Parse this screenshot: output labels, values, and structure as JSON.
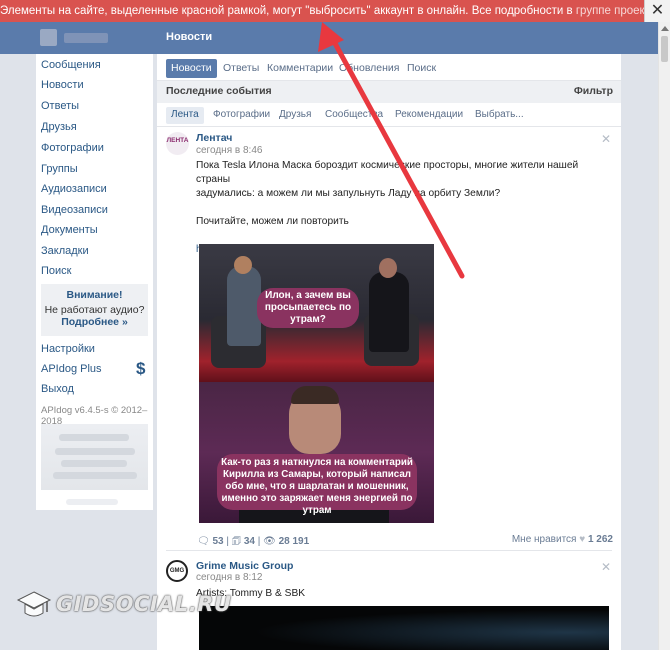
{
  "notice": {
    "text": "Элементы на сайте, выделенные красной рамкой, могут \"выбросить\" аккаунт в онлайн. Все подробности в ",
    "link": "группе проекта",
    "close": "✕"
  },
  "topbar": {
    "title": "Новости"
  },
  "sidebar": {
    "items": [
      "Сообщения",
      "Новости",
      "Ответы",
      "Друзья",
      "Фотографии",
      "Группы",
      "Аудиозаписи",
      "Видеозаписи",
      "Документы",
      "Закладки",
      "Поиск"
    ],
    "attention": {
      "title": "Внимание!",
      "text": "Не работают аудио?",
      "link": "Подробнее »"
    },
    "bottom_items": [
      "Настройки",
      "APIdog Plus",
      "Выход"
    ],
    "version": "APIdog v6.4.5-s © 2012–2018"
  },
  "tabs": [
    "Новости",
    "Ответы",
    "Комментарии",
    "Обновления",
    "Поиск"
  ],
  "events": {
    "title": "Последние события",
    "filter": "Фильтр"
  },
  "subtabs": [
    "Лента",
    "Фотографии",
    "Друзья",
    "Сообщества",
    "Рекомендации",
    "Выбрать..."
  ],
  "post1": {
    "logo": "ЛЕНТА",
    "author": "Лентач",
    "time": "сегодня в 8:46",
    "line1": "Пока Tesla Илона Маска бороздит космические просторы, многие жители нашей страны",
    "line2": "задумались: а можем ли мы запульнуть Ладу на орбиту Земли?",
    "line3": "Почитайте, можем ли повторить",
    "link": "http://news.lenta.ch/xGIT",
    "bubble1": "Илон, а зачем вы просыпаетесь по утрам?",
    "bubble2": "Как-то раз я наткнулся на комментарий Кирилла из Самары, который написал обо мне, что я шарлатан и мошенник, именно это заряжает меня энергией по утрам",
    "comments": "53",
    "reposts": "34",
    "views": "28 191",
    "likes_label": "Мне нравится",
    "likes": "1 262"
  },
  "post2": {
    "logo": "GMG",
    "author": "Grime Music Group",
    "time": "сегодня в 8:12",
    "text": "Artists: Tommy B & SBK"
  },
  "watermark": {
    "text": "GIDSOCIAL.RU"
  }
}
